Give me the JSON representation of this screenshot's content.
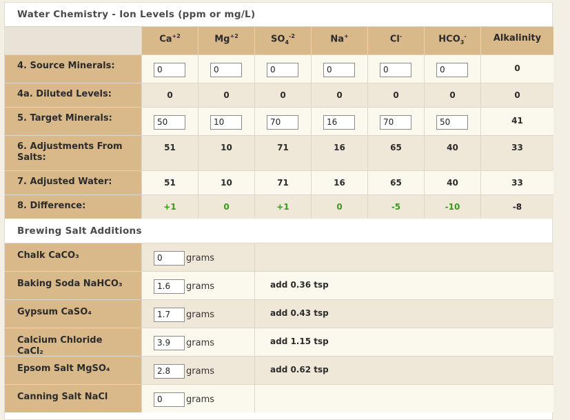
{
  "ions": {
    "title": "Water Chemistry - Ion Levels (ppm or mg/L)",
    "headers": [
      {
        "base": "Ca",
        "sup": "+2",
        "sub": ""
      },
      {
        "base": "Mg",
        "sup": "+2",
        "sub": ""
      },
      {
        "base": "SO",
        "sub": "4",
        "sup": "-2"
      },
      {
        "base": "Na",
        "sup": "+",
        "sub": ""
      },
      {
        "base": "Cl",
        "sup": "-",
        "sub": ""
      },
      {
        "base": "HCO",
        "sub": "3",
        "sup": "-"
      },
      {
        "base": "Alkalinity",
        "sup": "",
        "sub": ""
      }
    ],
    "rows": {
      "source": {
        "label": "4. Source Minerals:",
        "inputs": [
          "0",
          "0",
          "0",
          "0",
          "0",
          "0"
        ],
        "alkalinity": "0"
      },
      "diluted": {
        "label": "4a. Diluted Levels:",
        "values": [
          "0",
          "0",
          "0",
          "0",
          "0",
          "0",
          "0"
        ]
      },
      "target": {
        "label": "5. Target Minerals:",
        "inputs": [
          "50",
          "10",
          "70",
          "16",
          "70",
          "50"
        ],
        "alkalinity": "41"
      },
      "adjustments": {
        "label": "6. Adjustments From Salts:",
        "values": [
          "51",
          "10",
          "71",
          "16",
          "65",
          "40",
          "33"
        ]
      },
      "adjusted": {
        "label": "7. Adjusted Water:",
        "values": [
          "51",
          "10",
          "71",
          "16",
          "65",
          "40",
          "33"
        ]
      },
      "difference": {
        "label": "8. Difference:",
        "values": [
          "+1",
          "0",
          "+1",
          "0",
          "-5",
          "-10",
          "-8"
        ]
      }
    }
  },
  "salts": {
    "title": "Brewing Salt Additions",
    "unit": "grams",
    "items": [
      {
        "name": "Chalk CaCO₃",
        "grams": "0",
        "note": ""
      },
      {
        "name": "Baking Soda NaHCO₃",
        "grams": "1.6",
        "note": "add 0.36 tsp"
      },
      {
        "name": "Gypsum CaSO₄",
        "grams": "1.7",
        "note": "add 0.43 tsp"
      },
      {
        "name": "Calcium Chloride CaCl₂",
        "grams": "3.9",
        "note": "add 1.15 tsp"
      },
      {
        "name": "Epsom Salt MgSO₄",
        "grams": "2.8",
        "note": "add 0.62 tsp"
      },
      {
        "name": "Canning Salt NaCl",
        "grams": "0",
        "note": ""
      }
    ]
  },
  "colors": {
    "header_bg": "#d9b88a",
    "positive": "#3a9a1a",
    "negative": "#3a9a1a"
  }
}
